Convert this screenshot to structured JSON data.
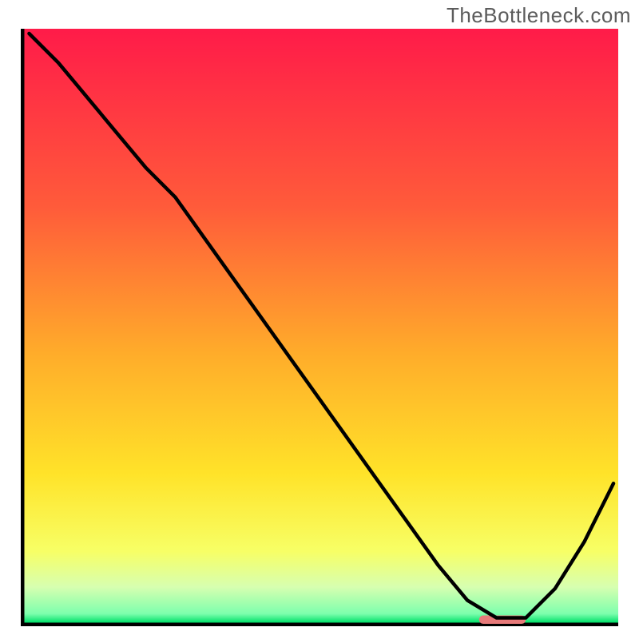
{
  "branding": {
    "site": "TheBottleneck.com"
  },
  "chart_data": {
    "type": "line",
    "x": [
      0,
      5,
      10,
      15,
      20,
      25,
      30,
      35,
      40,
      45,
      50,
      55,
      60,
      65,
      70,
      75,
      80,
      85,
      90,
      95,
      100
    ],
    "values": [
      100,
      95,
      89,
      83,
      77,
      72,
      65,
      58,
      51,
      44,
      37,
      30,
      23,
      16,
      9,
      3,
      0,
      0,
      5,
      13,
      23
    ],
    "marker_band": {
      "x_from": 77,
      "x_to": 85,
      "y": 0
    },
    "title": "",
    "xlabel": "",
    "ylabel": "",
    "xlim": [
      0,
      100
    ],
    "ylim": [
      0,
      100
    ],
    "axes_visible": true,
    "grid": false,
    "background_gradient": [
      {
        "stop": 0.0,
        "color": "#ff1b49"
      },
      {
        "stop": 0.3,
        "color": "#ff5b3a"
      },
      {
        "stop": 0.55,
        "color": "#ffad2a"
      },
      {
        "stop": 0.75,
        "color": "#ffe329"
      },
      {
        "stop": 0.88,
        "color": "#f7ff66"
      },
      {
        "stop": 0.94,
        "color": "#d7ffb0"
      },
      {
        "stop": 0.985,
        "color": "#7dffad"
      },
      {
        "stop": 1.0,
        "color": "#00e06a"
      }
    ],
    "marker_color": "#e77a7a",
    "curve_color": "#000000",
    "axis_color": "#000000",
    "curve_width": 3
  }
}
